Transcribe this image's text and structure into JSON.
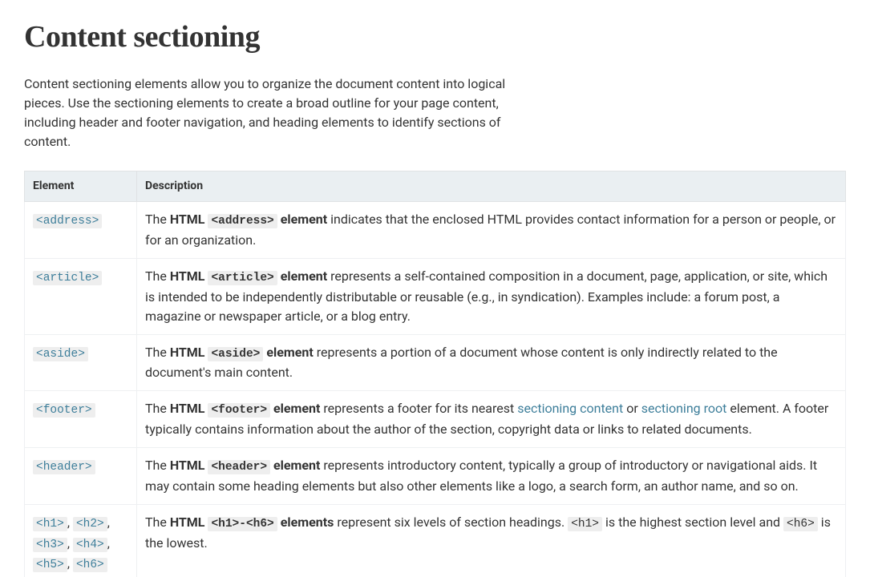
{
  "heading": "Content sectioning",
  "intro": "Content sectioning elements allow you to organize the document content into logical pieces. Use the sectioning elements to create a broad outline for your page content, including header and footer navigation, and heading elements to identify sections of content.",
  "table": {
    "col_element": "Element",
    "col_description": "Description",
    "rows": {
      "address": {
        "el": "<address>",
        "pre": "The ",
        "bold_html": "HTML ",
        "code": "<address>",
        "bold_tail": " element",
        "post": " indicates that the enclosed HTML provides contact information for a person or people, or for an organization."
      },
      "article": {
        "el": "<article>",
        "pre": "The ",
        "bold_html": "HTML ",
        "code": "<article>",
        "bold_tail": " element",
        "post": " represents a self-contained composition in a document, page, application, or site, which is intended to be independently distributable or reusable (e.g., in syndication). Examples include: a forum post, a magazine or newspaper article, or a blog entry."
      },
      "aside": {
        "el": "<aside>",
        "pre": "The ",
        "bold_html": "HTML ",
        "code": "<aside>",
        "bold_tail": " element",
        "post": " represents a portion of a document whose content is only indirectly related to the document's main content."
      },
      "footer": {
        "el": "<footer>",
        "pre": "The ",
        "bold_html": "HTML ",
        "code": "<footer>",
        "bold_tail": " element",
        "post1": " represents a footer for its nearest ",
        "link1": "sectioning content",
        "mid": " or ",
        "link2": "sectioning root",
        "post2": " element. A footer typically contains information about the author of the section, copyright data or links to related documents."
      },
      "header": {
        "el": "<header>",
        "pre": "The ",
        "bold_html": "HTML ",
        "code": "<header>",
        "bold_tail": " element",
        "post": " represents introductory content, typically a group of introductory or navigational aids. It may contain some heading elements but also other elements like a logo, a search form, an author name, and so on."
      },
      "headings": {
        "h1": "<h1>",
        "h2": "<h2>",
        "h3": "<h3>",
        "h4": "<h4>",
        "h5": "<h5>",
        "h6": "<h6>",
        "sep": ", ",
        "pre": "The ",
        "bold_html": "HTML ",
        "code": "<h1>-<h6>",
        "bold_tail": " elements",
        "post1": " represent six levels of section headings. ",
        "code_h1": "<h1>",
        "mid": " is the highest section level and ",
        "code_h6": "<h6>",
        "post2": " is the lowest."
      }
    }
  }
}
